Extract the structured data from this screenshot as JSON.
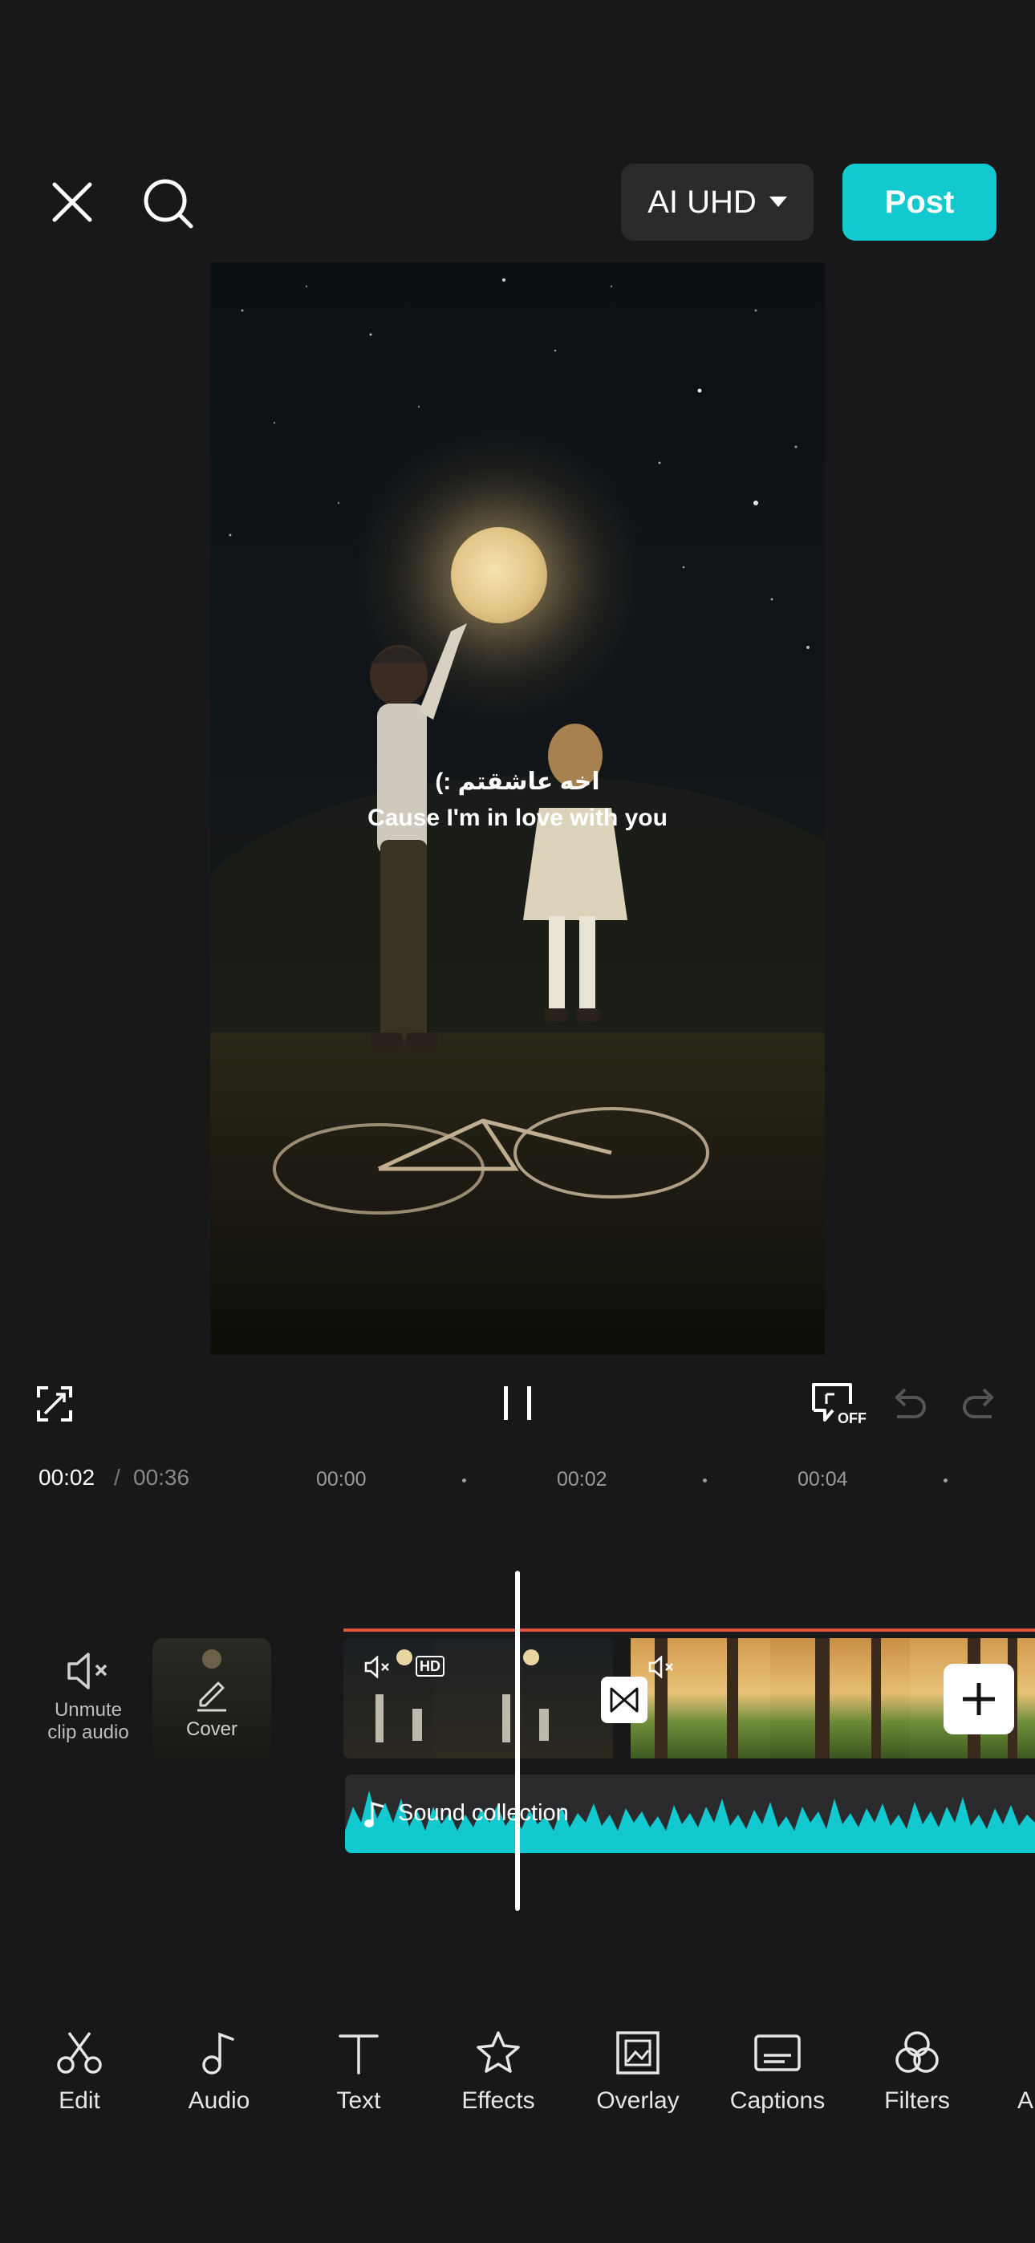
{
  "topbar": {
    "quality_label": "AI UHD",
    "post_label": "Post"
  },
  "preview": {
    "subtitle_fa": "اخه عاشقتم :)",
    "subtitle_en": "Cause I'm in love with you"
  },
  "playback": {
    "current_time": "00:02",
    "separator": "/",
    "total_time": "00:36",
    "ruler": [
      "00:00",
      "00:02",
      "00:04"
    ],
    "captions_toggle_state": "OFF"
  },
  "timeline": {
    "unmute_label_line1": "Unmute",
    "unmute_label_line2": "clip audio",
    "cover_label": "Cover",
    "clip_badge": "HD",
    "audio_track_label": "Sound collection"
  },
  "toolbar": {
    "items": [
      {
        "label": "Edit",
        "icon": "scissors-icon"
      },
      {
        "label": "Audio",
        "icon": "music-note-icon"
      },
      {
        "label": "Text",
        "icon": "text-icon"
      },
      {
        "label": "Effects",
        "icon": "effects-star-icon"
      },
      {
        "label": "Overlay",
        "icon": "overlay-icon"
      },
      {
        "label": "Captions",
        "icon": "captions-icon"
      },
      {
        "label": "Filters",
        "icon": "filters-icon"
      },
      {
        "label": "A",
        "icon": "more-tool-icon"
      }
    ]
  },
  "colors": {
    "accent": "#12c9d0",
    "background": "#18181a",
    "clip_border": "#e0533b",
    "waveform": "#12c9d0"
  }
}
